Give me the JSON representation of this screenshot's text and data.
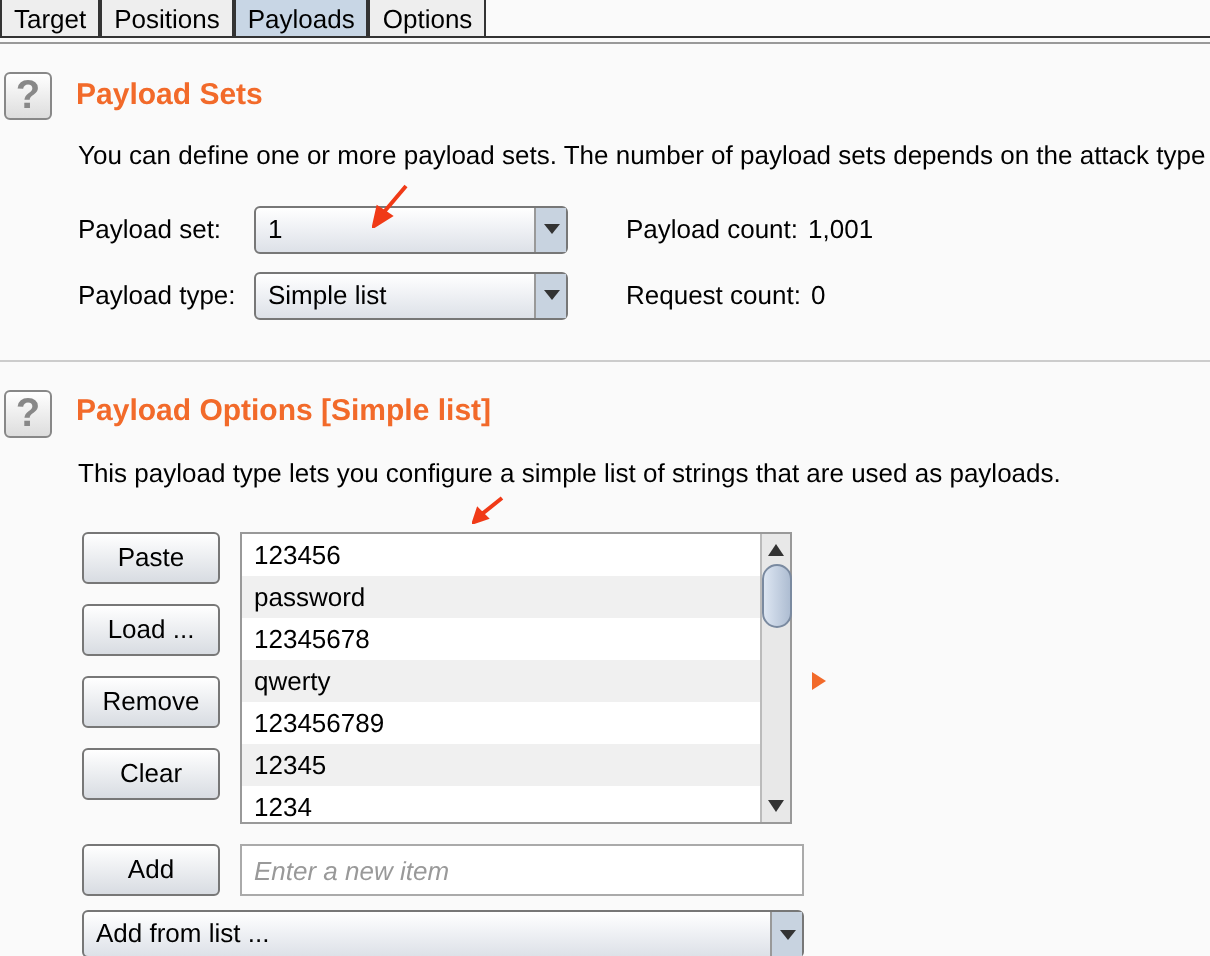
{
  "tabs": [
    {
      "label": "Target",
      "selected": false
    },
    {
      "label": "Positions",
      "selected": false
    },
    {
      "label": "Payloads",
      "selected": true
    },
    {
      "label": "Options",
      "selected": false
    }
  ],
  "payload_sets": {
    "help_icon": "?",
    "title": "Payload Sets",
    "description": "You can define one or more payload sets. The number of payload sets depends on the attack type",
    "fields": [
      {
        "label": "Payload set:",
        "value": "1",
        "info_label": "Payload count:",
        "info_value": "1,001"
      },
      {
        "label": "Payload type:",
        "value": "Simple list",
        "info_label": "Request count:",
        "info_value": "0"
      }
    ]
  },
  "payload_options": {
    "help_icon": "?",
    "title": "Payload Options [Simple list]",
    "description": "This payload type lets you configure a simple list of strings that are used as payloads.",
    "buttons": [
      "Paste",
      "Load ...",
      "Remove",
      "Clear"
    ],
    "items": [
      "123456",
      "password",
      "12345678",
      "qwerty",
      "123456789",
      "12345",
      "1234"
    ],
    "add_button": "Add",
    "new_item": {
      "placeholder": "Enter a new item"
    },
    "add_from_list": "Add from list ..."
  }
}
